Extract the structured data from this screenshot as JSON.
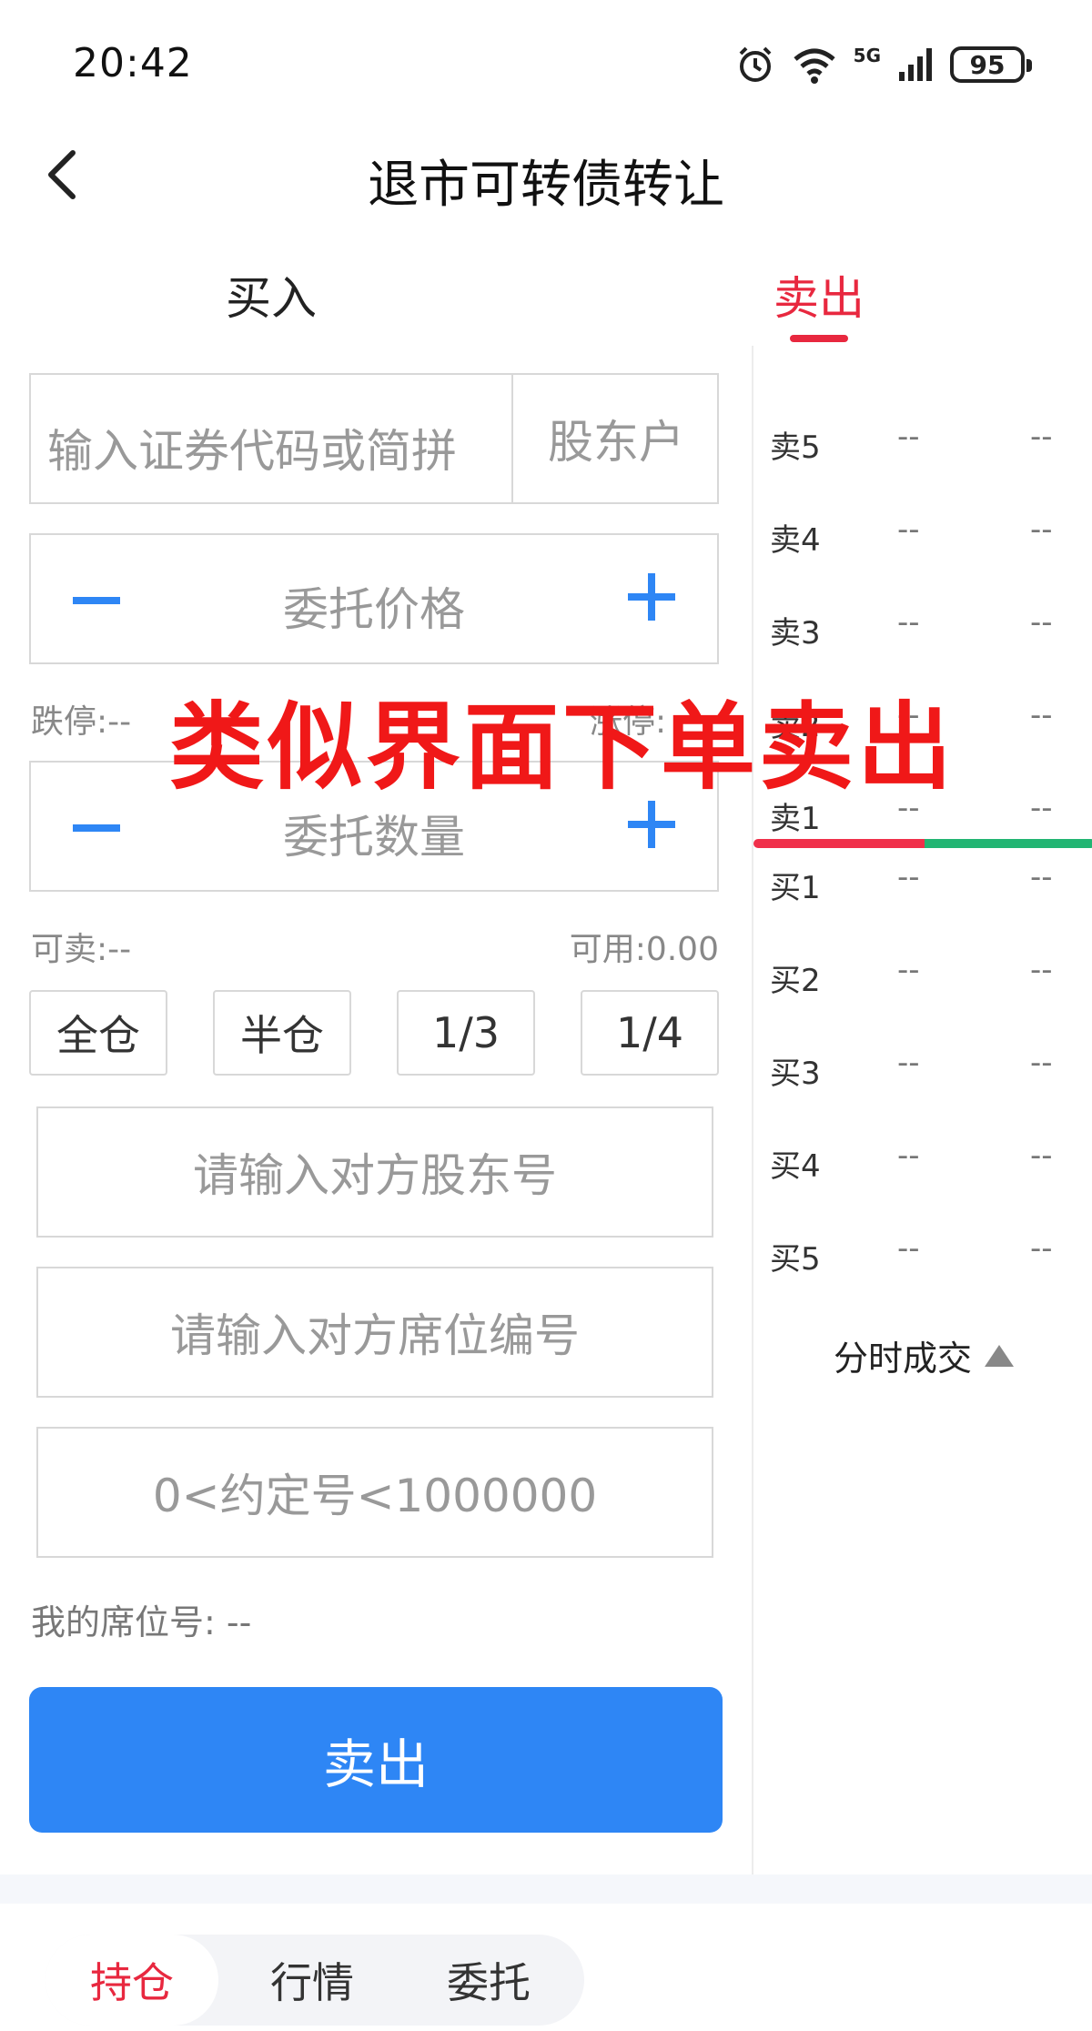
{
  "status_bar": {
    "time": "20:42",
    "network": "5G",
    "battery": "95"
  },
  "header": {
    "title": "退市可转债转让"
  },
  "tabs": {
    "buy": "买入",
    "sell": "卖出",
    "active": "sell",
    "active_color": "#e8283f"
  },
  "form": {
    "code_placeholder": "输入证券代码或简拼",
    "holder_account_label": "股东户",
    "price_placeholder": "委托价格",
    "limit_down_label": "跌停:--",
    "limit_up_label": "涨停:",
    "quantity_placeholder": "委托数量",
    "sellable_label": "可卖:--",
    "available_label": "可用:0.00",
    "quick_amounts": [
      "全仓",
      "半仓",
      "1/3",
      "1/4"
    ],
    "counterparty_holder_placeholder": "请输入对方股东号",
    "counterparty_seat_placeholder": "请输入对方席位编号",
    "agreement_no_placeholder": "0<约定号<1000000",
    "my_seat_label": "我的席位号:",
    "my_seat_value": "--",
    "submit_label": "卖出",
    "submit_color": "#2e86f5"
  },
  "order_book": {
    "rows": [
      {
        "level": "卖5",
        "price": "--",
        "volume": "--"
      },
      {
        "level": "卖4",
        "price": "--",
        "volume": "--"
      },
      {
        "level": "卖3",
        "price": "--",
        "volume": "--"
      },
      {
        "level": "卖2",
        "price": "--",
        "volume": "--"
      },
      {
        "level": "卖1",
        "price": "--",
        "volume": "--"
      },
      {
        "level": "买1",
        "price": "--",
        "volume": "--"
      },
      {
        "level": "买2",
        "price": "--",
        "volume": "--"
      },
      {
        "level": "买3",
        "price": "--",
        "volume": "--"
      },
      {
        "level": "买4",
        "price": "--",
        "volume": "--"
      },
      {
        "level": "买5",
        "price": "--",
        "volume": "--"
      }
    ],
    "trades_toggle_label": "分时成交",
    "sell_bar_color": "#f0304a",
    "buy_bar_color": "#22b573"
  },
  "annotation": {
    "text": "类似界面下单卖出",
    "color": "#f01818"
  },
  "bottom_tabs": {
    "items": [
      "持仓",
      "行情",
      "委托"
    ],
    "active": "持仓"
  }
}
